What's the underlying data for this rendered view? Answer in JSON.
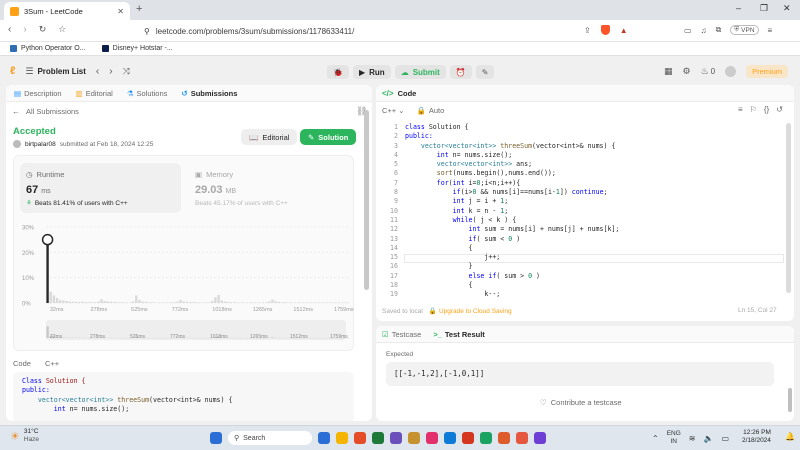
{
  "browser": {
    "tab_title": "3Sum - LeetCode",
    "new_tab": "+",
    "url": "leetcode.com/problems/3sum/submissions/1178633411/",
    "vpn_label": "VPN",
    "bookmarks": [
      {
        "label": "Python Operator O...",
        "color": "#2f6db5"
      },
      {
        "label": "Disney+ Hotstar -...",
        "color": "#0b1d4a"
      }
    ],
    "window_controls": [
      "–",
      "❐",
      "✕"
    ]
  },
  "header": {
    "problem_list": "Problem List",
    "run_label": "Run",
    "submit_label": "Submit",
    "fire_count": "0",
    "premium_label": "Premium"
  },
  "left_tabs": [
    "Description",
    "Editorial",
    "Solutions",
    "Submissions"
  ],
  "submission": {
    "back_label": "All Submissions",
    "status": "Accepted",
    "user": "birtpalar08",
    "submitted_at": "submitted at Feb 18, 2024 12:25",
    "editorial_btn": "Editorial",
    "solution_btn": "Solution",
    "runtime_label": "Runtime",
    "runtime_value": "67",
    "runtime_unit": "ms",
    "runtime_beats": "Beats 81.41% of users with C++",
    "memory_label": "Memory",
    "memory_value": "29.03",
    "memory_unit": "MB",
    "memory_beats": "Beats 45.17% of users with C++"
  },
  "chart_data": {
    "type": "bar",
    "yticks": [
      "30%",
      "20%",
      "10%",
      "0%"
    ],
    "ylim": [
      0,
      30
    ],
    "xticks": [
      "32ms",
      "278ms",
      "525ms",
      "772ms",
      "1018ms",
      "1265ms",
      "1512ms",
      "1759ms"
    ],
    "values": [
      25,
      4.5,
      3,
      2,
      1.2,
      1,
      0.8,
      0.6,
      0.5,
      0.5,
      0.4,
      0.5,
      0.4,
      0.3,
      0.3,
      0.3,
      0.6,
      1.5,
      0.8,
      0.6,
      0.5,
      0.4,
      0.3,
      0.3,
      0.3,
      0.2,
      0.2,
      0.6,
      3,
      1.2,
      0.6,
      0.5,
      0.3,
      0.3,
      0.2,
      0.2,
      0.2,
      0.2,
      0.2,
      0.3,
      0.3,
      0.5,
      1.2,
      0.6,
      0.5,
      0.4,
      0.3,
      0.3,
      0.2,
      0.2,
      0.2,
      0.2,
      0.8,
      2.2,
      3.2,
      1,
      0.6,
      0.4,
      0.3,
      0.3,
      0.2,
      0.2,
      0.2,
      0.2,
      0.2,
      0.2,
      0.2,
      0.2,
      0.2,
      0.2,
      0.6,
      1.4,
      0.7,
      0.4,
      0.3,
      0.3,
      0.2,
      0.2,
      0.2,
      0.2,
      0.2,
      0.2,
      0.2,
      0.2,
      0.2,
      0.2,
      0.2,
      0.2,
      0.2,
      0.2,
      0.2,
      0.2,
      0.2,
      0.2,
      0.2,
      0.2
    ],
    "highlight_index": 0,
    "mini_xticks": [
      "32ms",
      "278ms",
      "525ms",
      "772ms",
      "1018ms",
      "1265ms",
      "1512ms",
      "1759ms"
    ]
  },
  "left_code": {
    "tabs": [
      "Code",
      "C++"
    ],
    "lines": [
      [
        [
          "Class ",
          "kw"
        ],
        [
          "Solution {",
          "cm"
        ]
      ],
      [
        [
          "public:",
          "kw"
        ]
      ],
      [
        [
          "    vector<vector<int>> ",
          "ty"
        ],
        [
          "threeSum",
          "fn"
        ],
        [
          "(vector<int>& nums) {",
          ""
        ]
      ],
      [
        [
          "        int ",
          "kw"
        ],
        [
          "n= nums.size();",
          ""
        ]
      ]
    ]
  },
  "editor": {
    "title": "Code",
    "lang": "C++",
    "auto": "Auto",
    "saved": "Saved to local",
    "upgrade": "Upgrade to Cloud Saving",
    "position": "Ln 15, Col 27",
    "lines": [
      [
        [
          "class ",
          "kw"
        ],
        [
          "Solution {",
          ""
        ]
      ],
      [
        [
          "public:",
          "kw"
        ]
      ],
      [
        [
          "    vector<vector<int>> ",
          "ty"
        ],
        [
          "threeSum",
          "fn"
        ],
        [
          "(vector<int>& nums) {",
          ""
        ]
      ],
      [
        [
          "        int ",
          "kw"
        ],
        [
          "n= nums.size();",
          ""
        ]
      ],
      [
        [
          "        vector<vector<int>> ",
          "ty"
        ],
        [
          "ans;",
          ""
        ]
      ],
      [
        [
          "        ",
          ""
        ],
        [
          "sort",
          "fn"
        ],
        [
          "(nums.begin(),nums.end());",
          ""
        ]
      ],
      [
        [
          "        for",
          "kw"
        ],
        [
          "(",
          ""
        ],
        [
          "int ",
          "kw"
        ],
        [
          "i=",
          ""
        ],
        [
          "0",
          "nm"
        ],
        [
          ";i<n;i++){",
          ""
        ]
      ],
      [
        [
          "            if",
          "kw"
        ],
        [
          "(i>",
          ""
        ],
        [
          "0 ",
          "nm"
        ],
        [
          "&& nums[i]==nums[i-",
          ""
        ],
        [
          "1",
          "nm"
        ],
        [
          "]) ",
          ""
        ],
        [
          "continue",
          "kw"
        ],
        [
          ";",
          ""
        ]
      ],
      [
        [
          "            int ",
          "kw"
        ],
        [
          "j = i + ",
          ""
        ],
        [
          "1",
          "nm"
        ],
        [
          ";",
          ""
        ]
      ],
      [
        [
          "            int ",
          "kw"
        ],
        [
          "k = n - ",
          ""
        ],
        [
          "1",
          "nm"
        ],
        [
          ";",
          ""
        ]
      ],
      [
        [
          "            while",
          "kw"
        ],
        [
          "( j < k ) {",
          ""
        ]
      ],
      [
        [
          "                int ",
          "kw"
        ],
        [
          "sum = nums[i] + nums[j] + nums[k];",
          ""
        ]
      ],
      [
        [
          "                if",
          "kw"
        ],
        [
          "( sum < ",
          ""
        ],
        [
          "0",
          "nm"
        ],
        [
          " )",
          ""
        ]
      ],
      [
        [
          "                {",
          ""
        ]
      ],
      [
        [
          "                    j++;",
          ""
        ]
      ],
      [
        [
          "                }",
          ""
        ]
      ],
      [
        [
          "                else if",
          "kw"
        ],
        [
          "( sum > ",
          ""
        ],
        [
          "0",
          "nm"
        ],
        [
          " )",
          ""
        ]
      ],
      [
        [
          "                {",
          ""
        ]
      ],
      [
        [
          "                    k--;",
          ""
        ]
      ]
    ]
  },
  "testpanel": {
    "tab1": "Testcase",
    "tab2": "Test Result",
    "expected_label": "Expected",
    "expected_value": "[[-1,-1,2],[-1,0,1]]",
    "contribute": "Contribute a testcase"
  },
  "taskbar": {
    "temp": "31°C",
    "weather": "Haze",
    "search": "Search",
    "lang1": "ENG",
    "lang2": "IN",
    "time": "12:26 PM",
    "date": "2/18/2024",
    "apps": [
      "#2b6fd6",
      "#f4b400",
      "#e34c26",
      "#1f7a3a",
      "#6b4fbb",
      "#c6922f",
      "#e1306c",
      "#0f7bd8",
      "#d4361f",
      "#1aa260",
      "#de5b2c",
      "#e5573f",
      "#6d3fd4"
    ]
  }
}
